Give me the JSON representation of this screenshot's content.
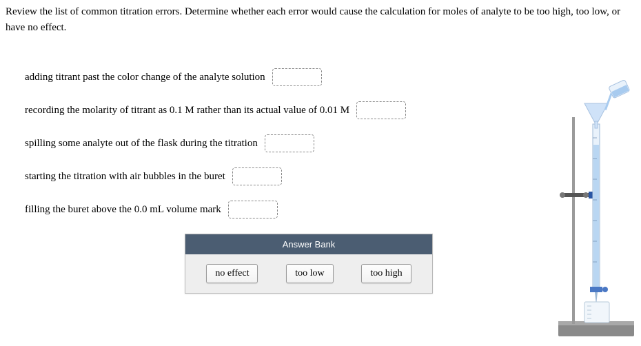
{
  "instructions": "Review the list of common titration errors. Determine whether each error would cause the calculation for moles of analyte to be too high, too low, or have no effect.",
  "questions": [
    {
      "text": "adding titrant past the color change of the analyte solution"
    },
    {
      "text": "recording the molarity of titrant as 0.1 M rather than its actual value of 0.01 M"
    },
    {
      "text": "spilling some analyte out of the flask during the titration"
    },
    {
      "text": "starting the titration with air bubbles in the buret"
    },
    {
      "text": "filling the buret above the 0.0 mL volume mark"
    }
  ],
  "answer_bank": {
    "title": "Answer Bank",
    "options": [
      "no effect",
      "too low",
      "too high"
    ]
  }
}
